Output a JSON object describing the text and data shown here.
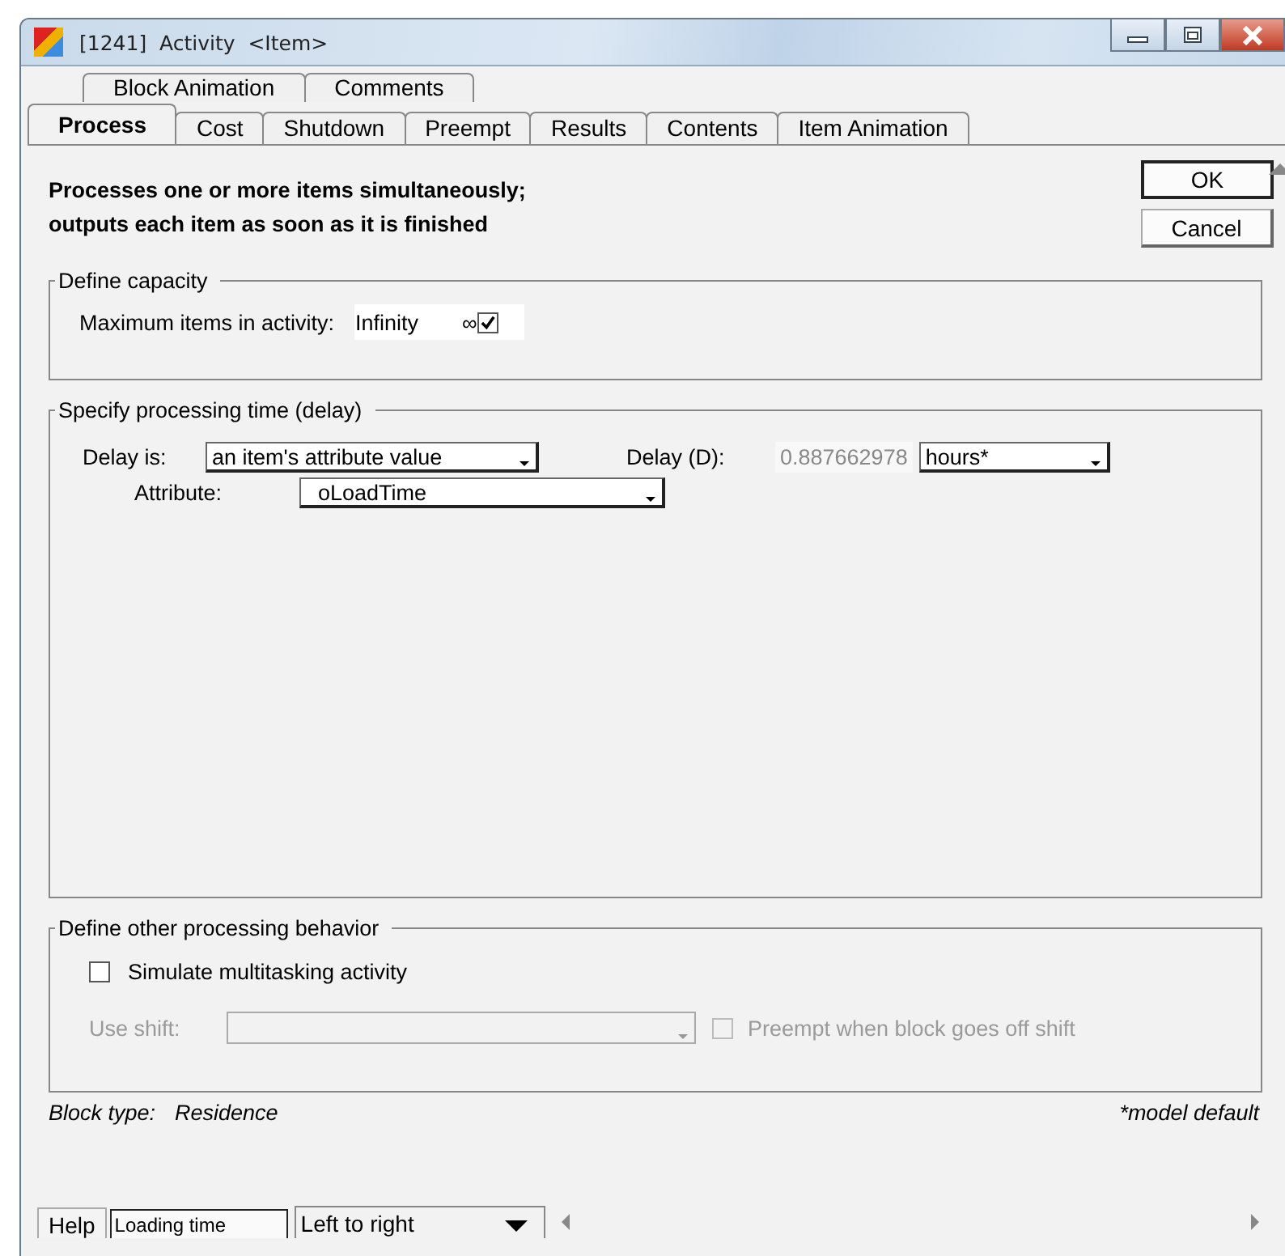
{
  "window": {
    "title": "[1241]  Activity  <Item>"
  },
  "tabs_back": [
    {
      "label": "Block Animation",
      "selected": false
    },
    {
      "label": "Comments",
      "selected": false
    }
  ],
  "tabs": [
    {
      "label": "Process",
      "selected": true
    },
    {
      "label": "Cost",
      "selected": false
    },
    {
      "label": "Shutdown",
      "selected": false
    },
    {
      "label": "Preempt",
      "selected": false
    },
    {
      "label": "Results",
      "selected": false
    },
    {
      "label": "Contents",
      "selected": false
    },
    {
      "label": "Item Animation",
      "selected": false
    }
  ],
  "description_lines": [
    "Processes one or more items simultaneously;",
    "outputs each item as soon as it is finished"
  ],
  "buttons": [
    {
      "label": "OK",
      "default": true
    },
    {
      "label": "Cancel",
      "default": false
    }
  ],
  "capacity": {
    "title": "Define capacity",
    "label": "Maximum items in activity:",
    "value": "Infinity",
    "symbol": "∞",
    "checked": true
  },
  "processing": {
    "title": "Specify processing time (delay)",
    "delay_label": "Delay is:",
    "delay_type": "an item's attribute value",
    "delay_d_label": "Delay (D):",
    "delay_value": "0.887662978",
    "units": "hours*",
    "attribute_label": "Attribute:",
    "attribute": "oLoadTime"
  },
  "other": {
    "title": "Define other processing behavior",
    "multitask": {
      "label": "Simulate multitasking activity",
      "checked": false
    },
    "shift_label": "Use shift:",
    "shift_disabled": true,
    "preempt": {
      "label": "Preempt when block goes off shift",
      "checked": false,
      "disabled": true
    }
  },
  "footer": {
    "block_type_label": "Block type:",
    "block_type": "Residence",
    "note": "*model default"
  },
  "bottom_bar": {
    "help": "Help",
    "name_field": "Loading time",
    "direction": "Left to right"
  }
}
